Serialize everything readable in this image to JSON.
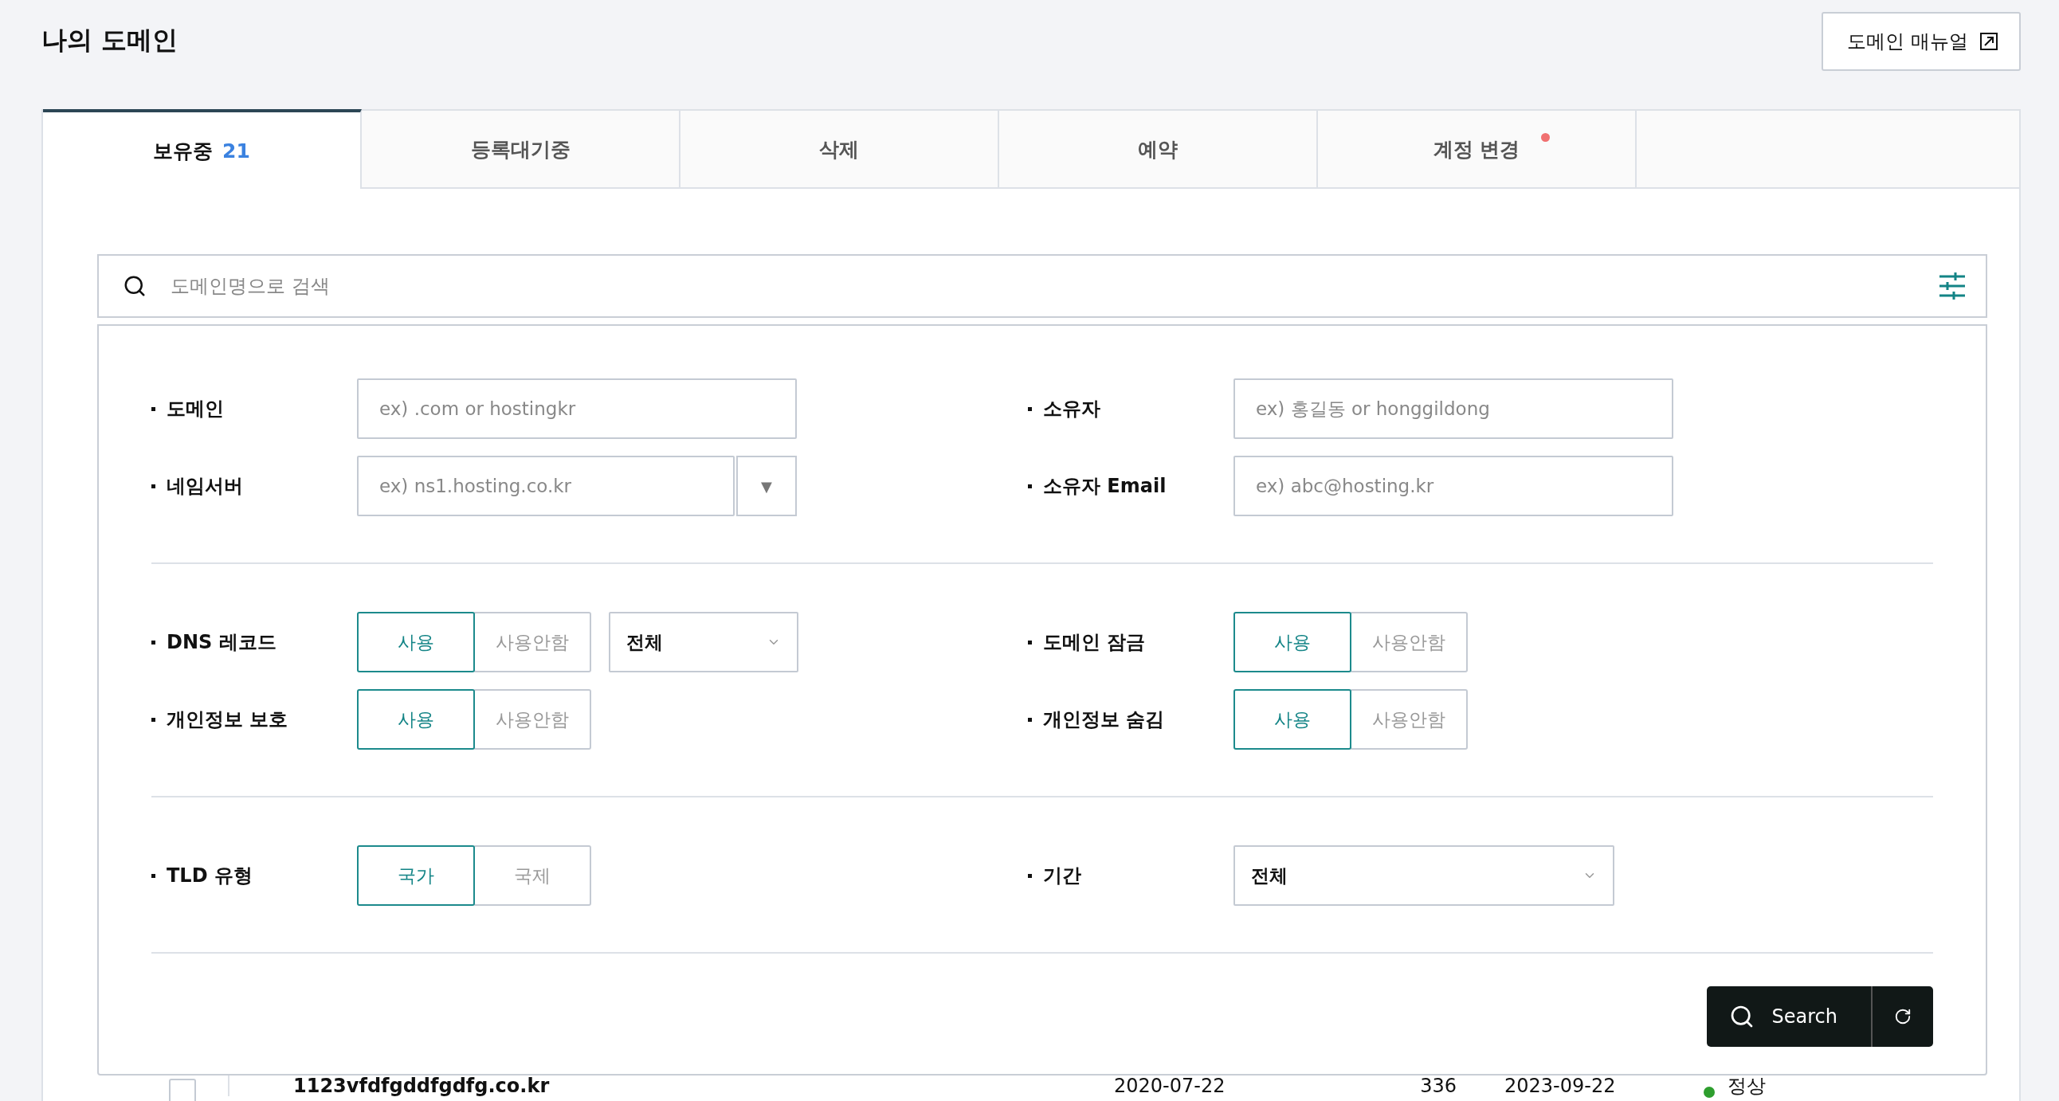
{
  "page": {
    "title": "나의 도메인",
    "manual_button": "도메인 매뉴얼"
  },
  "tabs": [
    {
      "label": "보유중",
      "count": "21",
      "selected": true,
      "notification": false
    },
    {
      "label": "등록대기중",
      "selected": false,
      "notification": false
    },
    {
      "label": "삭제",
      "selected": false,
      "notification": false
    },
    {
      "label": "예약",
      "selected": false,
      "notification": false
    },
    {
      "label": "계정 변경",
      "selected": false,
      "notification": true
    }
  ],
  "search": {
    "placeholder": "도메인명으로 검색"
  },
  "filters": [
    [
      {
        "left": {
          "kind": "text",
          "label": "도메인",
          "placeholder": "ex) .com or hostingkr"
        },
        "right": {
          "kind": "text",
          "label": "소유자",
          "placeholder": "ex) 홍길동 or honggildong"
        }
      },
      {
        "left": {
          "kind": "combo",
          "label": "네임서버",
          "placeholder": "ex) ns1.hosting.co.kr",
          "button": "▼"
        },
        "right": {
          "kind": "text",
          "label": "소유자 Email",
          "placeholder": "ex) abc@hosting.kr"
        }
      }
    ],
    [
      {
        "left": {
          "kind": "toggle",
          "label": "DNS 레코드",
          "options": [
            {
              "label": "사용",
              "selected": true
            },
            {
              "label": "사용안함",
              "selected": false
            }
          ],
          "select": "전체"
        },
        "right": {
          "kind": "toggle",
          "label": "도메인 잠금",
          "options": [
            {
              "label": "사용",
              "selected": true
            },
            {
              "label": "사용안함",
              "selected": false
            }
          ]
        }
      },
      {
        "left": {
          "kind": "toggle",
          "label": "개인정보 보호",
          "options": [
            {
              "label": "사용",
              "selected": true
            },
            {
              "label": "사용안함",
              "selected": false
            }
          ]
        },
        "right": {
          "kind": "toggle",
          "label": "개인정보 숨김",
          "options": [
            {
              "label": "사용",
              "selected": true
            },
            {
              "label": "사용안함",
              "selected": false
            }
          ]
        }
      }
    ],
    [
      {
        "left": {
          "kind": "toggle",
          "label": "TLD 유형",
          "options": [
            {
              "label": "국가",
              "selected": true
            },
            {
              "label": "국제",
              "selected": false
            }
          ]
        },
        "right": {
          "kind": "select",
          "label": "기간",
          "value": "전체"
        }
      }
    ]
  ],
  "actions": {
    "search_button": "Search"
  },
  "table_rows": [
    {
      "checked": false,
      "domain": "1123vfdfgddfgdfg.co.kr",
      "registered": "2020-07-22",
      "days_left": "336",
      "expires": "2023-09-22",
      "status": "정상",
      "color": "#2e9e2e"
    }
  ]
}
